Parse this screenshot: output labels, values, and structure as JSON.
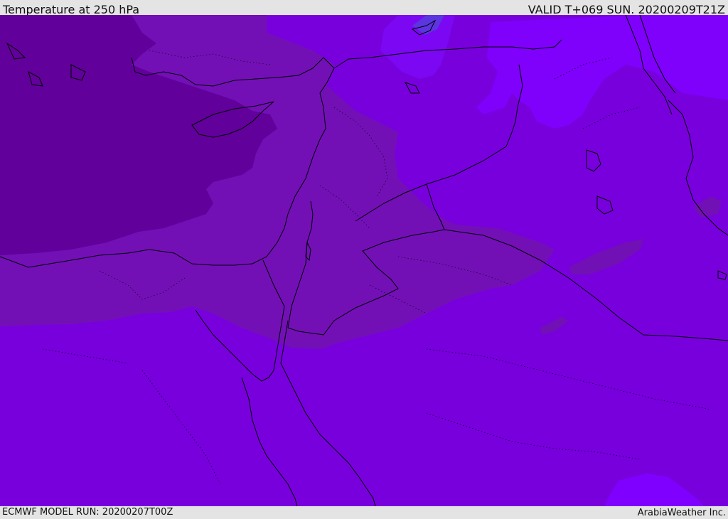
{
  "header": {
    "title": "Temperature at 250 hPa",
    "valid": "VALID T+069 SUN. 20200209T21Z"
  },
  "footer": {
    "model_run": "ECMWF MODEL RUN: 20200207T00Z",
    "brand": "ArabiaWeather Inc."
  },
  "map": {
    "colors": {
      "coldest": "#61009a",
      "cold": "#7110b4",
      "mid": "#7800dd",
      "warm": "#8000ff",
      "warmest": "#6b2fe6",
      "border": "#000000"
    }
  }
}
